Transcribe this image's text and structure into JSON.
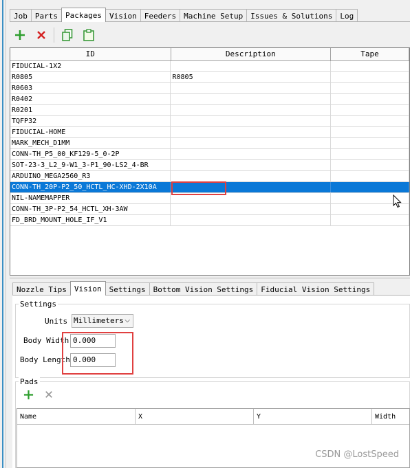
{
  "top_tabs": [
    "Job",
    "Parts",
    "Packages",
    "Vision",
    "Feeders",
    "Machine Setup",
    "Issues & Solutions",
    "Log"
  ],
  "active_tab": "Packages",
  "toolbar": {
    "icons": [
      "add-icon",
      "delete-icon",
      "copy-icon",
      "paste-icon"
    ],
    "colors": {
      "add": "#2e9e2e",
      "delete": "#d42020",
      "copy": "#4aa84a"
    }
  },
  "packages_table": {
    "columns": [
      "ID",
      "Description",
      "Tape"
    ],
    "rows": [
      {
        "id": "FIDUCIAL-1X2",
        "description": ""
      },
      {
        "id": "R0805",
        "description": "R0805"
      },
      {
        "id": "R0603",
        "description": ""
      },
      {
        "id": "R0402",
        "description": ""
      },
      {
        "id": "R0201",
        "description": ""
      },
      {
        "id": "TQFP32",
        "description": ""
      },
      {
        "id": "FIDUCIAL-HOME",
        "description": ""
      },
      {
        "id": "MARK_MECH_D1MM",
        "description": ""
      },
      {
        "id": "CONN-TH_P5_00_KF129-5_0-2P",
        "description": ""
      },
      {
        "id": "SOT-23-3_L2_9-W1_3-P1_90-LS2_4-BR",
        "description": ""
      },
      {
        "id": "ARDUINO_MEGA2560_R3",
        "description": ""
      },
      {
        "id": "CONN-TH_20P-P2_50_HCTL_HC-XHD-2X10A",
        "description": ""
      },
      {
        "id": "NIL-NAMEMAPPER",
        "description": ""
      },
      {
        "id": "CONN-TH_3P-P2_54_HCTL_XH-3AW",
        "description": ""
      },
      {
        "id": "FD_BRD_MOUNT_HOLE_IF_V1",
        "description": ""
      }
    ],
    "selected_row": "CONN-TH_20P-P2_50_HCTL_HC-XHD-2X10A",
    "selection_color": "#0a78d7"
  },
  "sub_tabs": [
    "Nozzle Tips",
    "Vision",
    "Settings",
    "Bottom Vision Settings",
    "Fiducial Vision Settings"
  ],
  "active_sub_tab": "Vision",
  "settings": {
    "title": "Settings",
    "units_label": "Units",
    "units_value": "Millimeters",
    "body_width_label": "Body Width",
    "body_width_value": "0.000",
    "body_length_label": "Body Length",
    "body_length_value": "0.000"
  },
  "pads": {
    "title": "Pads",
    "columns": [
      "Name",
      "X",
      "Y",
      "Width"
    ]
  },
  "highlight_color": "#e04040",
  "watermark": "CSDN @LostSpeed"
}
